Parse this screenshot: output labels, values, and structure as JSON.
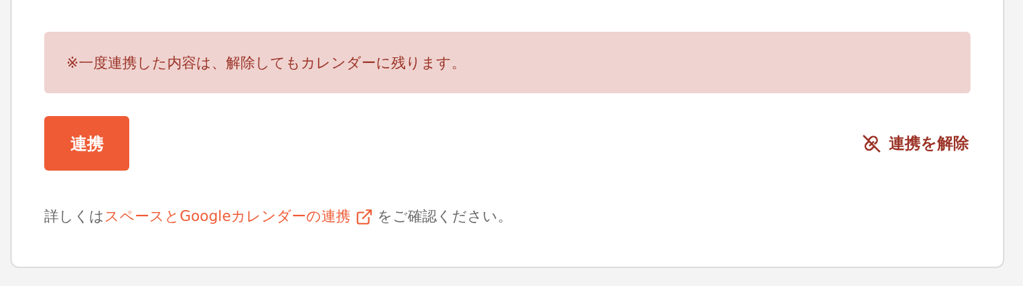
{
  "notice": {
    "text": "※一度連携した内容は、解除してもカレンダーに残ります。"
  },
  "actions": [
    {
      "kind": "primary",
      "label": "連携"
    },
    {
      "kind": "unlink",
      "label": "連携を解除"
    }
  ],
  "footer": {
    "before": "詳しくは",
    "link": "スペースとGoogleカレンダーの連携",
    "after": "をご確認ください。"
  }
}
